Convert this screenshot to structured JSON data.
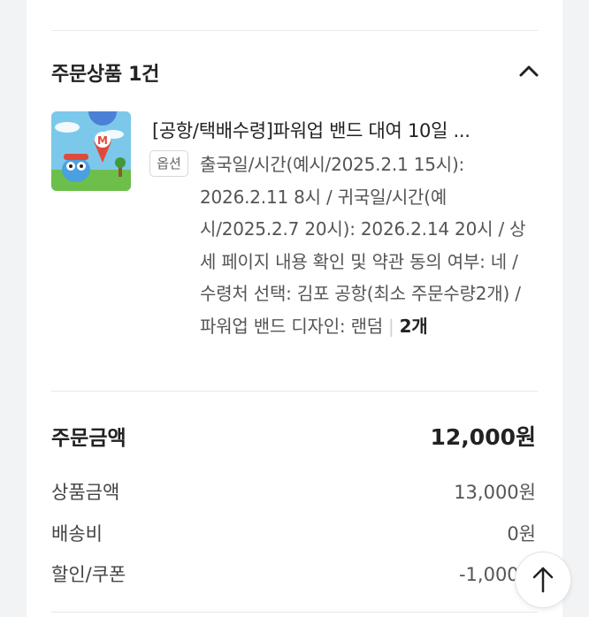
{
  "order_items": {
    "title": "주문상품 1건",
    "product": {
      "title": "[공항/택배수령]파워업 밴드 대여 10일 ...",
      "option_badge": "옵션",
      "option_text": "출국일/시간(예시/2025.2.1 15시): 2026.2.11 8시 / 귀국일/시간(예시/2025.2.7 20시): 2026.2.14 20시 / 상세 페이지 내용 확인 및 약관 동의 여부: 네 / 수령처 선택: 김포 공항(최소 주문수량2개) / 파워업 밴드 디자인: 랜덤",
      "quantity": "2개"
    }
  },
  "summary": {
    "total_label": "주문금액",
    "total_value": "12,000원",
    "rows": [
      {
        "label": "상품금액",
        "value": "13,000원"
      },
      {
        "label": "배송비",
        "value": "0원"
      },
      {
        "label": "할인/쿠폰",
        "value": "-1,000원"
      }
    ]
  },
  "icons": {
    "collapse": "chevron-up-icon",
    "scroll_top": "arrow-up-icon"
  },
  "colors": {
    "background": "#f2f3f5",
    "card": "#ffffff",
    "text": "#222222"
  }
}
